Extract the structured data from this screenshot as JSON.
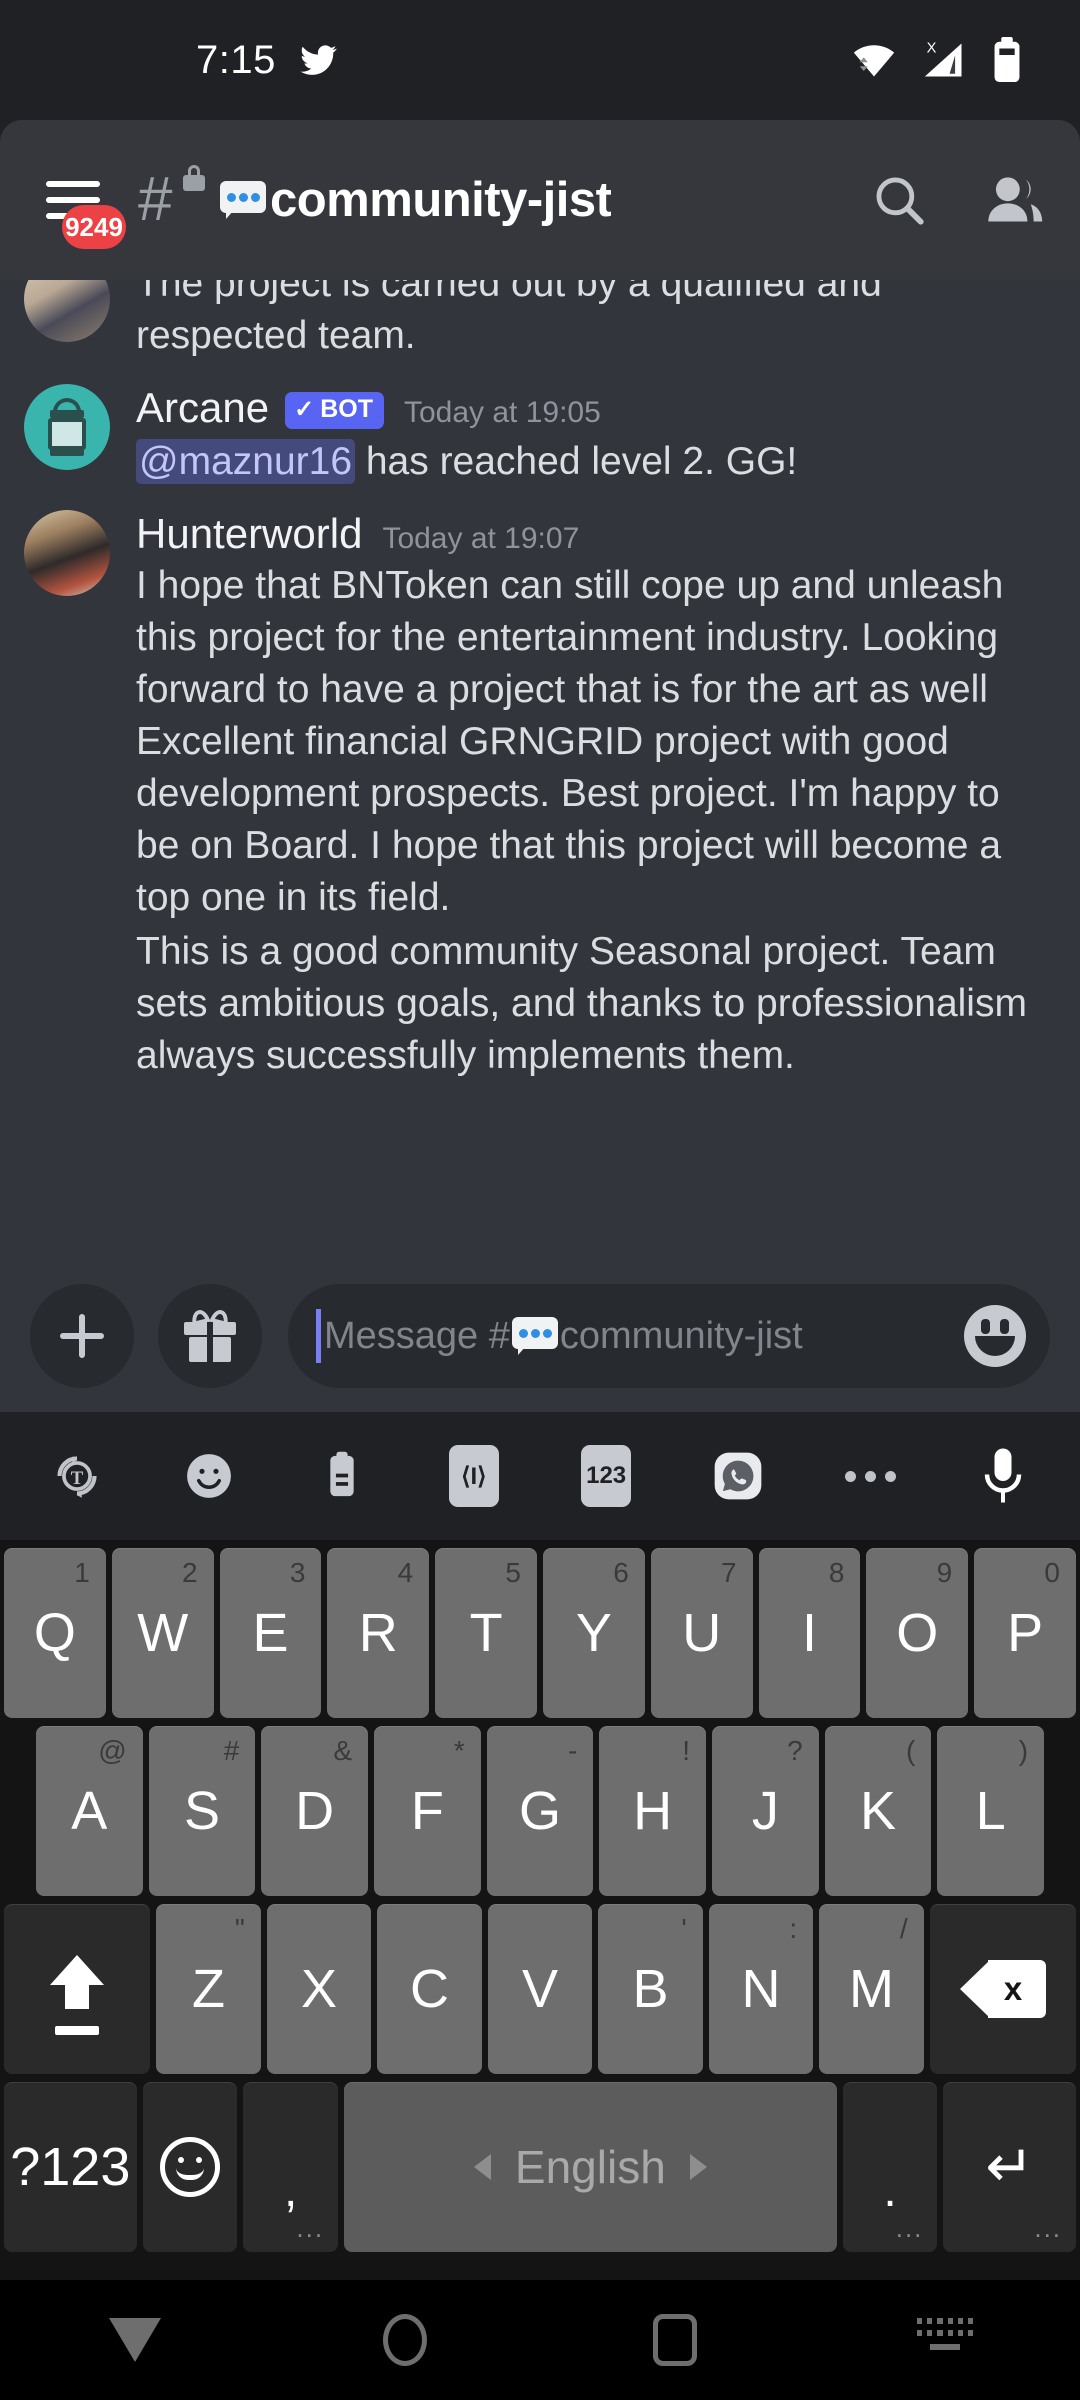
{
  "status_bar": {
    "time": "7:15",
    "icons": [
      "twitter-bird-icon",
      "wifi-icon",
      "cellular-no-sim-icon",
      "battery-icon"
    ]
  },
  "header": {
    "menu_badge": "9249",
    "channel_hash": "#",
    "channel_emoji": "speech-balloon",
    "channel_name": "community-jist",
    "lock": "locked",
    "search_label": "Search",
    "members_label": "Members"
  },
  "messages": [
    {
      "author": "",
      "timestamp": "",
      "is_bot": false,
      "partial": true,
      "avatar": "av-photo1",
      "text": "The project is carried out by a qualified and respected team."
    },
    {
      "author": "Arcane",
      "bot_badge": "BOT",
      "bot_check": "✓",
      "timestamp": "Today at 19:05",
      "is_bot": true,
      "avatar": "av-bot",
      "mention": "@maznur16",
      "text": " has reached level 2. GG!"
    },
    {
      "author": "Hunterworld",
      "timestamp": "Today at 19:07",
      "is_bot": false,
      "avatar": "av-photo2",
      "paragraph1": "I hope that BNToken can still cope up and unleash this project for the entertainment industry. Looking forward to have a project that is for the art as well Excellent financial GRNGRID project with good development prospects. Best project. I'm happy to be on Board. I hope that this project will become a top one in its field.",
      "paragraph2": "This is a good community Seasonal project. Team sets ambitious goals, and thanks to professionalism always successfully implements them."
    }
  ],
  "input_bar": {
    "add_label": "+",
    "gift_label": "Gift",
    "placeholder_prefix": "Message #",
    "placeholder_channel": "community-jist",
    "emoji_label": "Emoji"
  },
  "keyboard_toolbar": {
    "items": [
      {
        "name": "translate-icon",
        "label": "T"
      },
      {
        "name": "emoji-icon",
        "label": ""
      },
      {
        "name": "clipboard-icon",
        "label": ""
      },
      {
        "name": "text-format-icon",
        "label": "⟨I⟩"
      },
      {
        "name": "numbers-icon",
        "label": "123"
      },
      {
        "name": "sticker-icon",
        "label": ""
      },
      {
        "name": "overflow-icon",
        "label": "•••"
      },
      {
        "name": "microphone-icon",
        "label": ""
      }
    ]
  },
  "keyboard": {
    "row1": [
      {
        "key": "Q",
        "hint": "1"
      },
      {
        "key": "W",
        "hint": "2"
      },
      {
        "key": "E",
        "hint": "3"
      },
      {
        "key": "R",
        "hint": "4"
      },
      {
        "key": "T",
        "hint": "5"
      },
      {
        "key": "Y",
        "hint": "6"
      },
      {
        "key": "U",
        "hint": "7"
      },
      {
        "key": "I",
        "hint": "8"
      },
      {
        "key": "O",
        "hint": "9"
      },
      {
        "key": "P",
        "hint": "0"
      }
    ],
    "row2": [
      {
        "key": "A",
        "hint": "@"
      },
      {
        "key": "S",
        "hint": "#"
      },
      {
        "key": "D",
        "hint": "&"
      },
      {
        "key": "F",
        "hint": "*"
      },
      {
        "key": "G",
        "hint": "-"
      },
      {
        "key": "H",
        "hint": "!"
      },
      {
        "key": "J",
        "hint": "?"
      },
      {
        "key": "K",
        "hint": "("
      },
      {
        "key": "L",
        "hint": ")"
      }
    ],
    "row3": [
      {
        "key": "Z",
        "hint": "\""
      },
      {
        "key": "X",
        "hint": ""
      },
      {
        "key": "C",
        "hint": ""
      },
      {
        "key": "V",
        "hint": ""
      },
      {
        "key": "B",
        "hint": "'"
      },
      {
        "key": "N",
        "hint": ":"
      },
      {
        "key": "M",
        "hint": "/"
      }
    ],
    "shift_label": "Shift",
    "backspace_label": "Backspace",
    "symbols_key": "?123",
    "emoji_key": "Emoji",
    "comma_key": ",",
    "space_key": "English",
    "period_key": ".",
    "enter_key": "↵",
    "long_press_hint": "..."
  },
  "nav_bar": {
    "back": "back-icon",
    "home": "home-icon",
    "recents": "recents-icon",
    "keyboard_switch": "keyboard-switcher-icon"
  }
}
